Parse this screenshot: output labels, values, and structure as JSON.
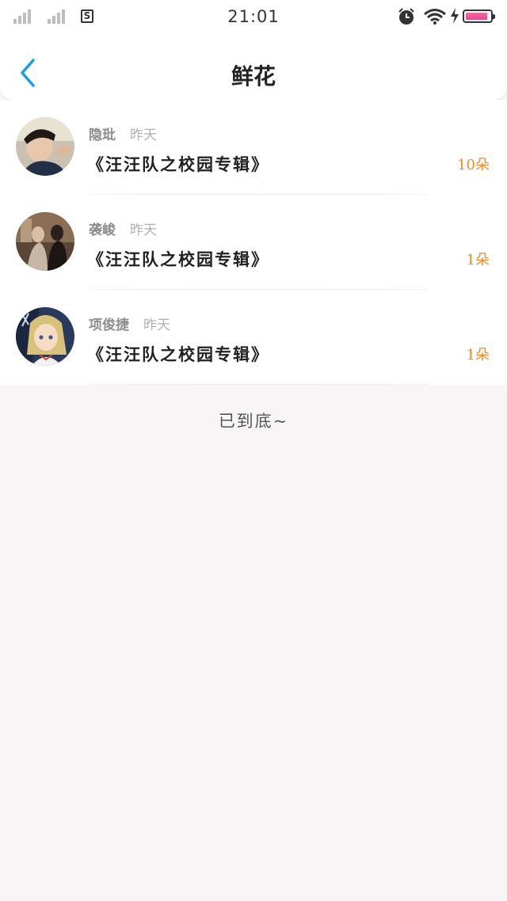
{
  "status_bar": {
    "time": "21:01",
    "sim_label": "S",
    "battery_level": 0.9,
    "icons": [
      "signal-icon",
      "sim-icon",
      "alarm-icon",
      "wifi-icon",
      "charging-icon",
      "battery-icon"
    ]
  },
  "nav": {
    "title": "鲜花",
    "back_icon": "chevron-left-icon",
    "accent_color": "#1a9bf0"
  },
  "list": {
    "items": [
      {
        "name": "隐玭",
        "time": "昨天",
        "work": "《汪汪队之校园专辑》",
        "count": "10朵"
      },
      {
        "name": "袭峻",
        "time": "昨天",
        "work": "《汪汪队之校园专辑》",
        "count": "1朵"
      },
      {
        "name": "项俊捷",
        "time": "昨天",
        "work": "《汪汪队之校园专辑》",
        "count": "1朵"
      }
    ],
    "count_color": "#f28a2c"
  },
  "footer": {
    "end_text": "已到底~"
  }
}
